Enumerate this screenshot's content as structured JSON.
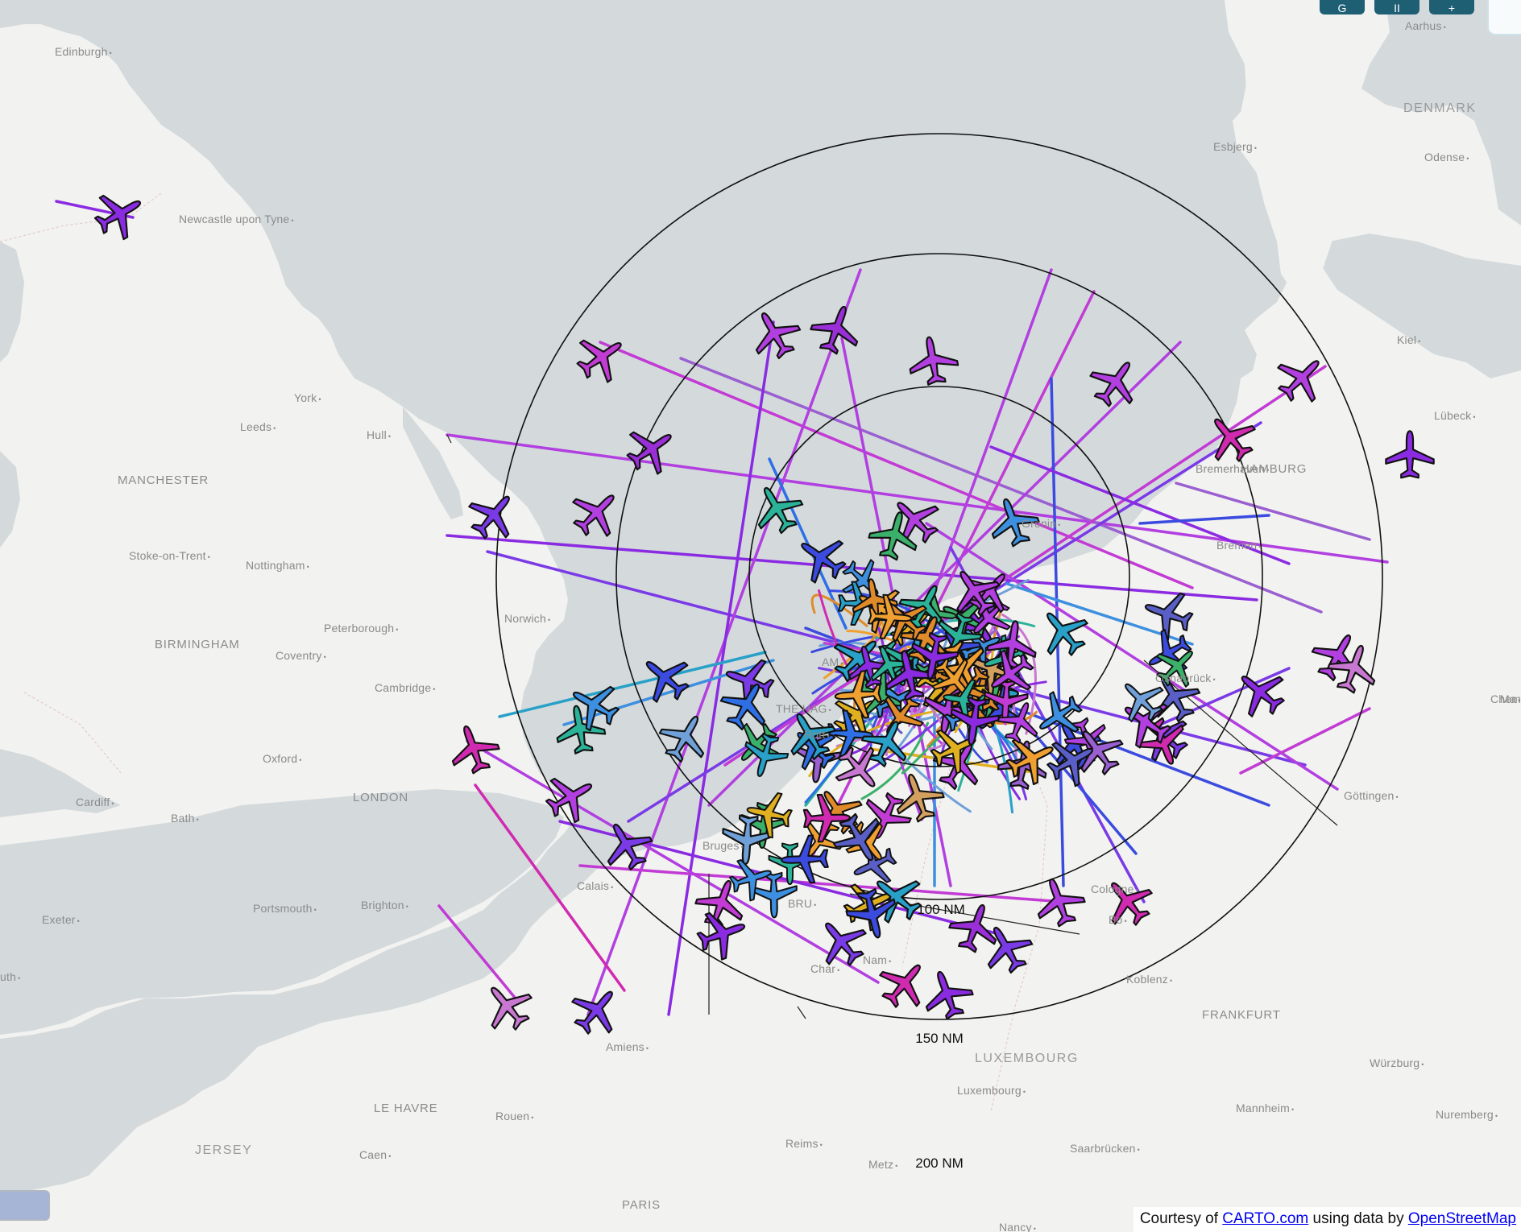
{
  "map": {
    "colors": {
      "water": "#d4dadc",
      "land": "#f2f2f0",
      "ring": "#111111"
    },
    "place_labels": [
      {
        "text": "Edinburgh",
        "style": "city"
      },
      {
        "text": "Newcastle upon Tyne",
        "style": "city"
      },
      {
        "text": "York",
        "style": "city"
      },
      {
        "text": "Leeds",
        "style": "city"
      },
      {
        "text": "Hull",
        "style": "city"
      },
      {
        "text": "MANCHESTER",
        "style": "big"
      },
      {
        "text": "Stoke-on-Trent",
        "style": "city"
      },
      {
        "text": "Nottingham",
        "style": "city"
      },
      {
        "text": "Norwich",
        "style": "city"
      },
      {
        "text": "Peterborough",
        "style": "city"
      },
      {
        "text": "BIRMINGHAM",
        "style": "big"
      },
      {
        "text": "Coventry",
        "style": "city"
      },
      {
        "text": "Cambridge",
        "style": "city"
      },
      {
        "text": "Oxford",
        "style": "city"
      },
      {
        "text": "LONDON",
        "style": "big"
      },
      {
        "text": "Cardiff",
        "style": "city"
      },
      {
        "text": "Bath",
        "style": "city"
      },
      {
        "text": "Portsmouth",
        "style": "city"
      },
      {
        "text": "Brighton",
        "style": "city"
      },
      {
        "text": "Exeter",
        "style": "city"
      },
      {
        "text": "Calais",
        "style": "city"
      },
      {
        "text": "Bruges",
        "style": "city"
      },
      {
        "text": "Amiens",
        "style": "city"
      },
      {
        "text": "LE HAVRE",
        "style": "big"
      },
      {
        "text": "Rouen",
        "style": "city"
      },
      {
        "text": "JERSEY",
        "style": "country"
      },
      {
        "text": "Caen",
        "style": "city"
      },
      {
        "text": "Reims",
        "style": "city"
      },
      {
        "text": "PARIS",
        "style": "big"
      },
      {
        "text": "Metz",
        "style": "city"
      },
      {
        "text": "Nancy",
        "style": "city"
      },
      {
        "text": "Saarbrücken",
        "style": "city"
      },
      {
        "text": "Luxembourg",
        "style": "city"
      },
      {
        "text": "LUXEMBOURG",
        "style": "country"
      },
      {
        "text": "Koblenz",
        "style": "city"
      },
      {
        "text": "FRANKFURT",
        "style": "big"
      },
      {
        "text": "Mannheim",
        "style": "city"
      },
      {
        "text": "Würzburg",
        "style": "city"
      },
      {
        "text": "Nuremberg",
        "style": "city"
      },
      {
        "text": "Göttingen",
        "style": "city"
      },
      {
        "text": "Osnabrück",
        "style": "city"
      },
      {
        "text": "Bremen",
        "style": "city"
      },
      {
        "text": "Bremerhaven",
        "style": "city"
      },
      {
        "text": "HAMBURG",
        "style": "big"
      },
      {
        "text": "Lübeck",
        "style": "city"
      },
      {
        "text": "Kiel",
        "style": "city"
      },
      {
        "text": "Odense",
        "style": "city"
      },
      {
        "text": "Esbjerg",
        "style": "city"
      },
      {
        "text": "DENMARK",
        "style": "country"
      },
      {
        "text": "Aarhus",
        "style": "city"
      },
      {
        "text": "Chemnitz",
        "style": "city"
      },
      {
        "text": "AM",
        "style": "city"
      },
      {
        "text": "THE HAG",
        "style": "city"
      },
      {
        "text": "Rott",
        "style": "city"
      },
      {
        "text": "BRU",
        "style": "city"
      },
      {
        "text": "Char",
        "style": "city"
      },
      {
        "text": "Nam",
        "style": "city"
      },
      {
        "text": "Gronin",
        "style": "city"
      },
      {
        "text": "Cologne",
        "style": "city"
      },
      {
        "text": "Bo",
        "style": "city"
      },
      {
        "text": "Ma",
        "style": "city"
      },
      {
        "text": "uth",
        "style": "city"
      }
    ],
    "range_rings": [
      {
        "label": "100 NM"
      },
      {
        "label": "150 NM"
      },
      {
        "label": "200 NM"
      }
    ],
    "aircraft_palette": [
      "#b23fe0",
      "#8a2be2",
      "#7a3ae6",
      "#c23bd4",
      "#3b4be0",
      "#2e6fe6",
      "#3d8fe0",
      "#28a0c8",
      "#2bb39a",
      "#3ab06a",
      "#e08a2a",
      "#f0a030",
      "#e0b020",
      "#d02ab0",
      "#9a5fd0",
      "#5a5fc8",
      "#6fa0d8",
      "#c878d0"
    ],
    "aircraft_count_drawn": 140
  },
  "controls": {
    "buttons": [
      {
        "label": "G"
      },
      {
        "label": "II"
      },
      {
        "label": "+"
      }
    ]
  },
  "attribution": {
    "prefix": "Courtesy of ",
    "link1": "CARTO.com",
    "middle": " using data by ",
    "link2": "OpenStreetMap"
  }
}
